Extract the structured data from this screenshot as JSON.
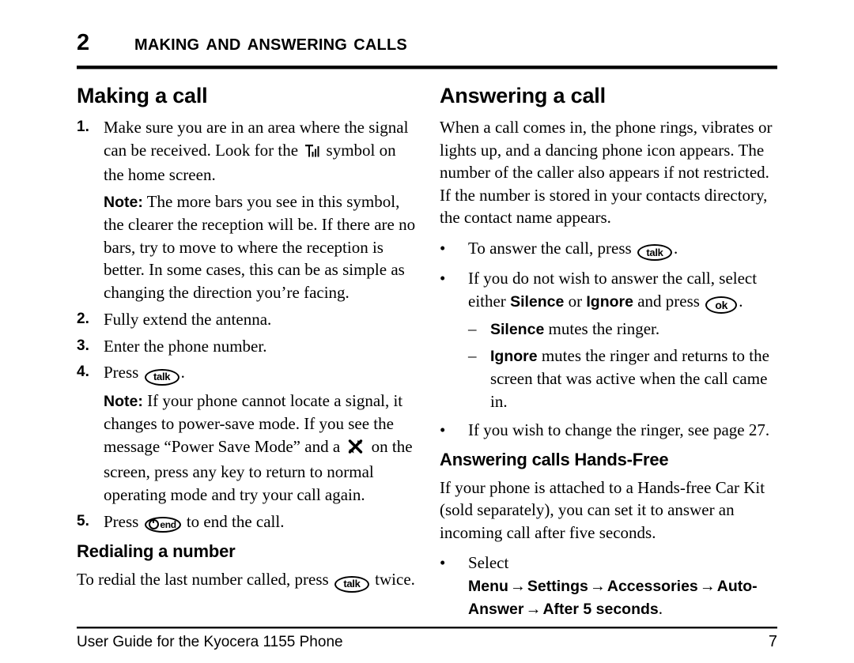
{
  "chapter": {
    "number": "2",
    "title": "Making and Answering Calls"
  },
  "left_column": {
    "heading": "Making a call",
    "steps": [
      {
        "number": "1.",
        "text_before_icon": "Make sure you are in an area where the signal can be received. Look for the",
        "icon": "signal-bars-icon",
        "text_after_icon": "symbol on the home screen."
      },
      {
        "number": "2.",
        "text": "Fully extend the antenna."
      },
      {
        "number": "3.",
        "text": "Enter the phone number."
      },
      {
        "number": "4.",
        "text_before_key": "Press",
        "key": "talk",
        "text_after_key": "."
      },
      {
        "number": "5.",
        "text_before_key": "Press",
        "key": "end",
        "text_after_key": "to end the call."
      }
    ],
    "note1": {
      "label": "Note:",
      "text": "The more bars you see in this symbol, the clearer the reception will be. If there are no bars, try to move to where the reception is better. In some cases, this can be as simple as changing the direction you’re facing."
    },
    "note2": {
      "label": "Note:",
      "text_before_icon": "If your phone cannot locate a signal, it changes to power-save mode. If you see the message “Power Save Mode” and a",
      "icon": "no-signal-icon",
      "text_after_icon": "on the screen, press any key to return to normal operating mode and try your call again."
    },
    "redial": {
      "heading": "Redialing a number",
      "text_before_key": "To redial the last number called, press",
      "key": "talk",
      "text_after_key": "twice."
    }
  },
  "right_column": {
    "heading": "Answering a call",
    "intro": "When a call comes in, the phone rings, vibrates or lights up, and a dancing phone icon appears. The number of the caller also appears if not restricted. If the number is stored in your contacts directory, the contact name appears.",
    "bullets": [
      {
        "marker": "•",
        "text_before_key": "To answer the call, press",
        "key": "talk",
        "text_after_key": "."
      },
      {
        "marker": "•",
        "text_part1": "If you do not wish to answer the call, select either",
        "bold1": "Silence",
        "text_part2": "or",
        "bold2": "Ignore",
        "text_part3": "and press",
        "key": "ok",
        "text_part4": "."
      }
    ],
    "sub_bullets": [
      {
        "marker": "–",
        "bold": "Silence",
        "text": "mutes the ringer."
      },
      {
        "marker": "–",
        "bold": "Ignore",
        "text": "mutes the ringer and returns to the screen that was active when the call came in."
      }
    ],
    "bullet_ringer": {
      "marker": "•",
      "text": "If you wish to change the ringer, see page 27."
    },
    "handsfree": {
      "heading": "Answering calls Hands-Free",
      "intro": "If your phone is attached to a Hands-free Car Kit (sold separately), you can set it to answer an incoming call after five seconds.",
      "bullet": {
        "marker": "•",
        "prefix": "Select",
        "path": [
          "Menu",
          "Settings",
          "Accessories",
          "Auto-Answer",
          "After 5 seconds"
        ],
        "arrow": "→",
        "suffix": "."
      }
    }
  },
  "footer": {
    "text": "User Guide for the Kyocera 1155 Phone",
    "page": "7"
  }
}
